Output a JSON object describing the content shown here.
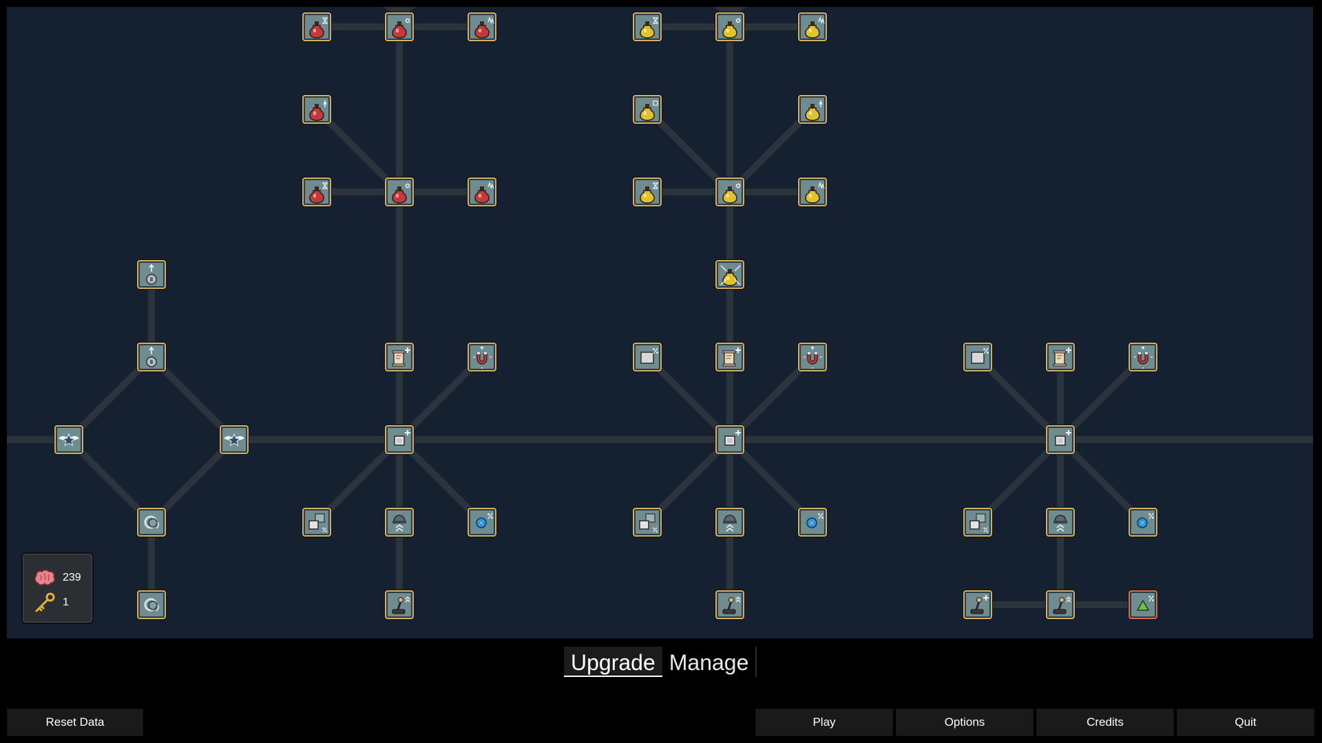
{
  "tabs": {
    "upgrade": "Upgrade",
    "manage": "Manage",
    "active": "Upgrade"
  },
  "currency": {
    "brains": "239",
    "keys": "1"
  },
  "buttons": {
    "reset": "Reset Data",
    "play": "Play",
    "options": "Options",
    "credits": "Credits",
    "quit": "Quit"
  },
  "colors": {
    "background": "#000000",
    "tree_bg": "#152131",
    "link": "#2b333c",
    "node_bg": "#6f8c90",
    "node_border": "#d7b15e",
    "node_border_special": "#d66b55"
  },
  "tree": {
    "nodes": [
      {
        "id": "n1",
        "icon": "potion-red-hourglass-icon"
      },
      {
        "id": "n2",
        "icon": "potion-red-gear-icon"
      },
      {
        "id": "n3",
        "icon": "potion-red-arrows-icon"
      },
      {
        "id": "n4",
        "icon": "potion-red-up-icon"
      },
      {
        "id": "n5",
        "icon": "potion-red-hourglass-icon"
      },
      {
        "id": "n6",
        "icon": "potion-red-gear-icon"
      },
      {
        "id": "n7",
        "icon": "potion-red-arrows-icon"
      },
      {
        "id": "n8",
        "icon": "potion-yellow-hourglass-icon"
      },
      {
        "id": "n9",
        "icon": "potion-yellow-gear-icon"
      },
      {
        "id": "n10",
        "icon": "potion-yellow-arrows-icon"
      },
      {
        "id": "n11",
        "icon": "potion-yellow-square-icon"
      },
      {
        "id": "n12",
        "icon": "potion-yellow-up-icon"
      },
      {
        "id": "n13",
        "icon": "potion-yellow-hourglass-icon"
      },
      {
        "id": "n14",
        "icon": "potion-yellow-gear-icon"
      },
      {
        "id": "n15",
        "icon": "potion-yellow-arrows-icon"
      },
      {
        "id": "n16",
        "icon": "potion-yellow-burst-icon"
      },
      {
        "id": "n17",
        "icon": "coin-up-icon"
      },
      {
        "id": "n18",
        "icon": "coin-up-icon"
      },
      {
        "id": "n19",
        "icon": "winged-star-icon"
      },
      {
        "id": "n20",
        "icon": "winged-star-icon"
      },
      {
        "id": "n21",
        "icon": "orbit-icon"
      },
      {
        "id": "n22",
        "icon": "orbit-icon"
      },
      {
        "id": "n23",
        "icon": "scroll-plus-icon"
      },
      {
        "id": "n24",
        "icon": "magnet-icon"
      },
      {
        "id": "n25",
        "icon": "box-plus-icon"
      },
      {
        "id": "n26",
        "icon": "boxes-percent-icon"
      },
      {
        "id": "n27",
        "icon": "turret-up-icon"
      },
      {
        "id": "n28",
        "icon": "gem-percent-icon"
      },
      {
        "id": "n29",
        "icon": "joystick-up-icon"
      },
      {
        "id": "n30",
        "icon": "box-percent-icon"
      },
      {
        "id": "n31",
        "icon": "scroll-plus-icon"
      },
      {
        "id": "n32",
        "icon": "magnet-icon"
      },
      {
        "id": "n33",
        "icon": "box-plus-icon"
      },
      {
        "id": "n34",
        "icon": "boxes-percent-icon"
      },
      {
        "id": "n35",
        "icon": "turret-up-icon"
      },
      {
        "id": "n36",
        "icon": "gem-percent-icon"
      },
      {
        "id": "n37",
        "icon": "joystick-up-icon"
      },
      {
        "id": "n38",
        "icon": "box-percent-icon"
      },
      {
        "id": "n39",
        "icon": "scroll-plus-icon"
      },
      {
        "id": "n40",
        "icon": "magnet-icon"
      },
      {
        "id": "n41",
        "icon": "box-plus-icon"
      },
      {
        "id": "n42",
        "icon": "boxes-percent-icon"
      },
      {
        "id": "n43",
        "icon": "turret-up-icon"
      },
      {
        "id": "n44",
        "icon": "gem-percent-icon"
      },
      {
        "id": "n45",
        "icon": "joystick-plus-icon"
      },
      {
        "id": "n46",
        "icon": "joystick-up-icon"
      },
      {
        "id": "n47",
        "icon": "triangle-percent-icon"
      }
    ]
  }
}
